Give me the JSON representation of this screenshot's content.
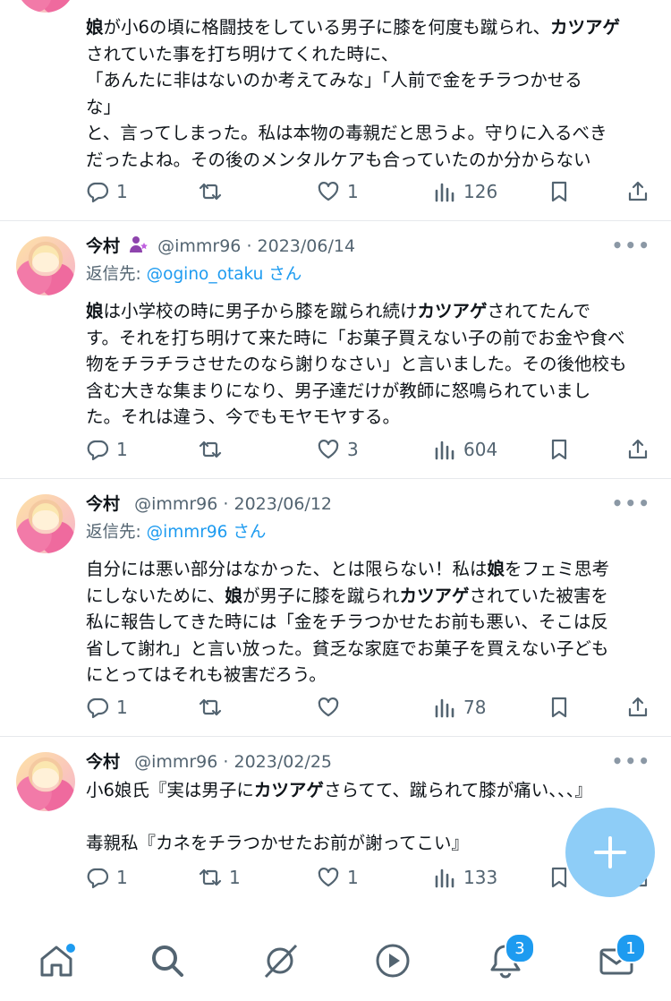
{
  "tweets": [
    {
      "body_segments": [
        {
          "t": "娘",
          "b": true
        },
        {
          "t": "が小6の頃に格闘技をしている男子に膝を何度も蹴られ、",
          "b": false
        },
        {
          "t": "カツアゲ",
          "b": true
        },
        {
          "t": "\nされていた事を打ち明けてくれた時に、\n「あんたに非はないのか考えてみな」「人前で金をチラつかせる\nな」\nと、言ってしまった。私は本物の毒親だと思うよ。守りに入るべき\nだったよね。その後のメンタルケアも合っていたのか分からない",
          "b": false
        }
      ],
      "replies": "1",
      "retweets": "",
      "likes": "1",
      "views": "126"
    },
    {
      "name": "今村",
      "badge_icon": "female-purple-icon",
      "handle": "@immr96",
      "date": "· 2023/06/14",
      "reply_prefix": "返信先: ",
      "reply_to": "@ogino_otaku",
      "reply_suffix": " さん",
      "body_segments": [
        {
          "t": "娘",
          "b": true
        },
        {
          "t": "は小学校の時に男子から膝を蹴られ続け",
          "b": false
        },
        {
          "t": "カツアゲ",
          "b": true
        },
        {
          "t": "されてたんで\nす。それを打ち明けて来た時に「お菓子買えない子の前でお金や食べ\n物をチラチラさせたのなら謝りなさい」と言いました。その後他校も\n含む大きな集まりになり、男子達だけが教師に怒鳴られていまし\nた。それは違う、今でもモヤモヤする。",
          "b": false
        }
      ],
      "replies": "1",
      "retweets": "",
      "likes": "3",
      "views": "604"
    },
    {
      "name": "今村",
      "handle": "@immr96",
      "date": "· 2023/06/12",
      "reply_prefix": "返信先: ",
      "reply_to": "@immr96",
      "reply_suffix": " さん",
      "body_segments": [
        {
          "t": "自分には悪い部分はなかった、とは限らない！私は",
          "b": false
        },
        {
          "t": "娘",
          "b": true
        },
        {
          "t": "をフェミ思考\nにしないために、",
          "b": false
        },
        {
          "t": "娘",
          "b": true
        },
        {
          "t": "が男子に膝を蹴られ",
          "b": false
        },
        {
          "t": "カツアゲ",
          "b": true
        },
        {
          "t": "されていた被害を\n私に報告してきた時には「金をチラつかせたお前も悪い、そこは反\n省して謝れ」と言い放った。貧乏な家庭でお菓子を買えない子ども\nにとってはそれも被害だろう。",
          "b": false
        }
      ],
      "replies": "1",
      "retweets": "",
      "likes": "",
      "views": "78"
    },
    {
      "name": "今村",
      "handle": "@immr96",
      "date": "· 2023/02/25",
      "body_segments": [
        {
          "t": "小6娘氏『実は男子に",
          "b": false
        },
        {
          "t": "カツアゲ",
          "b": true
        },
        {
          "t": "さらてて、蹴られて膝が痛い、、、』\n\n毒親私『カネをチラつかせたお前が謝ってこい』",
          "b": false
        }
      ],
      "replies": "1",
      "retweets": "1",
      "likes": "1",
      "views": "133"
    }
  ],
  "nav": {
    "items": [
      "home-icon",
      "search-icon",
      "grok-icon",
      "video-icon",
      "bell-icon",
      "mail-icon"
    ],
    "notifications_badge": "3",
    "messages_badge": "1"
  },
  "colors": {
    "accent": "#1d9bf0",
    "fab": "#8ecdf7",
    "muted": "#536471"
  }
}
